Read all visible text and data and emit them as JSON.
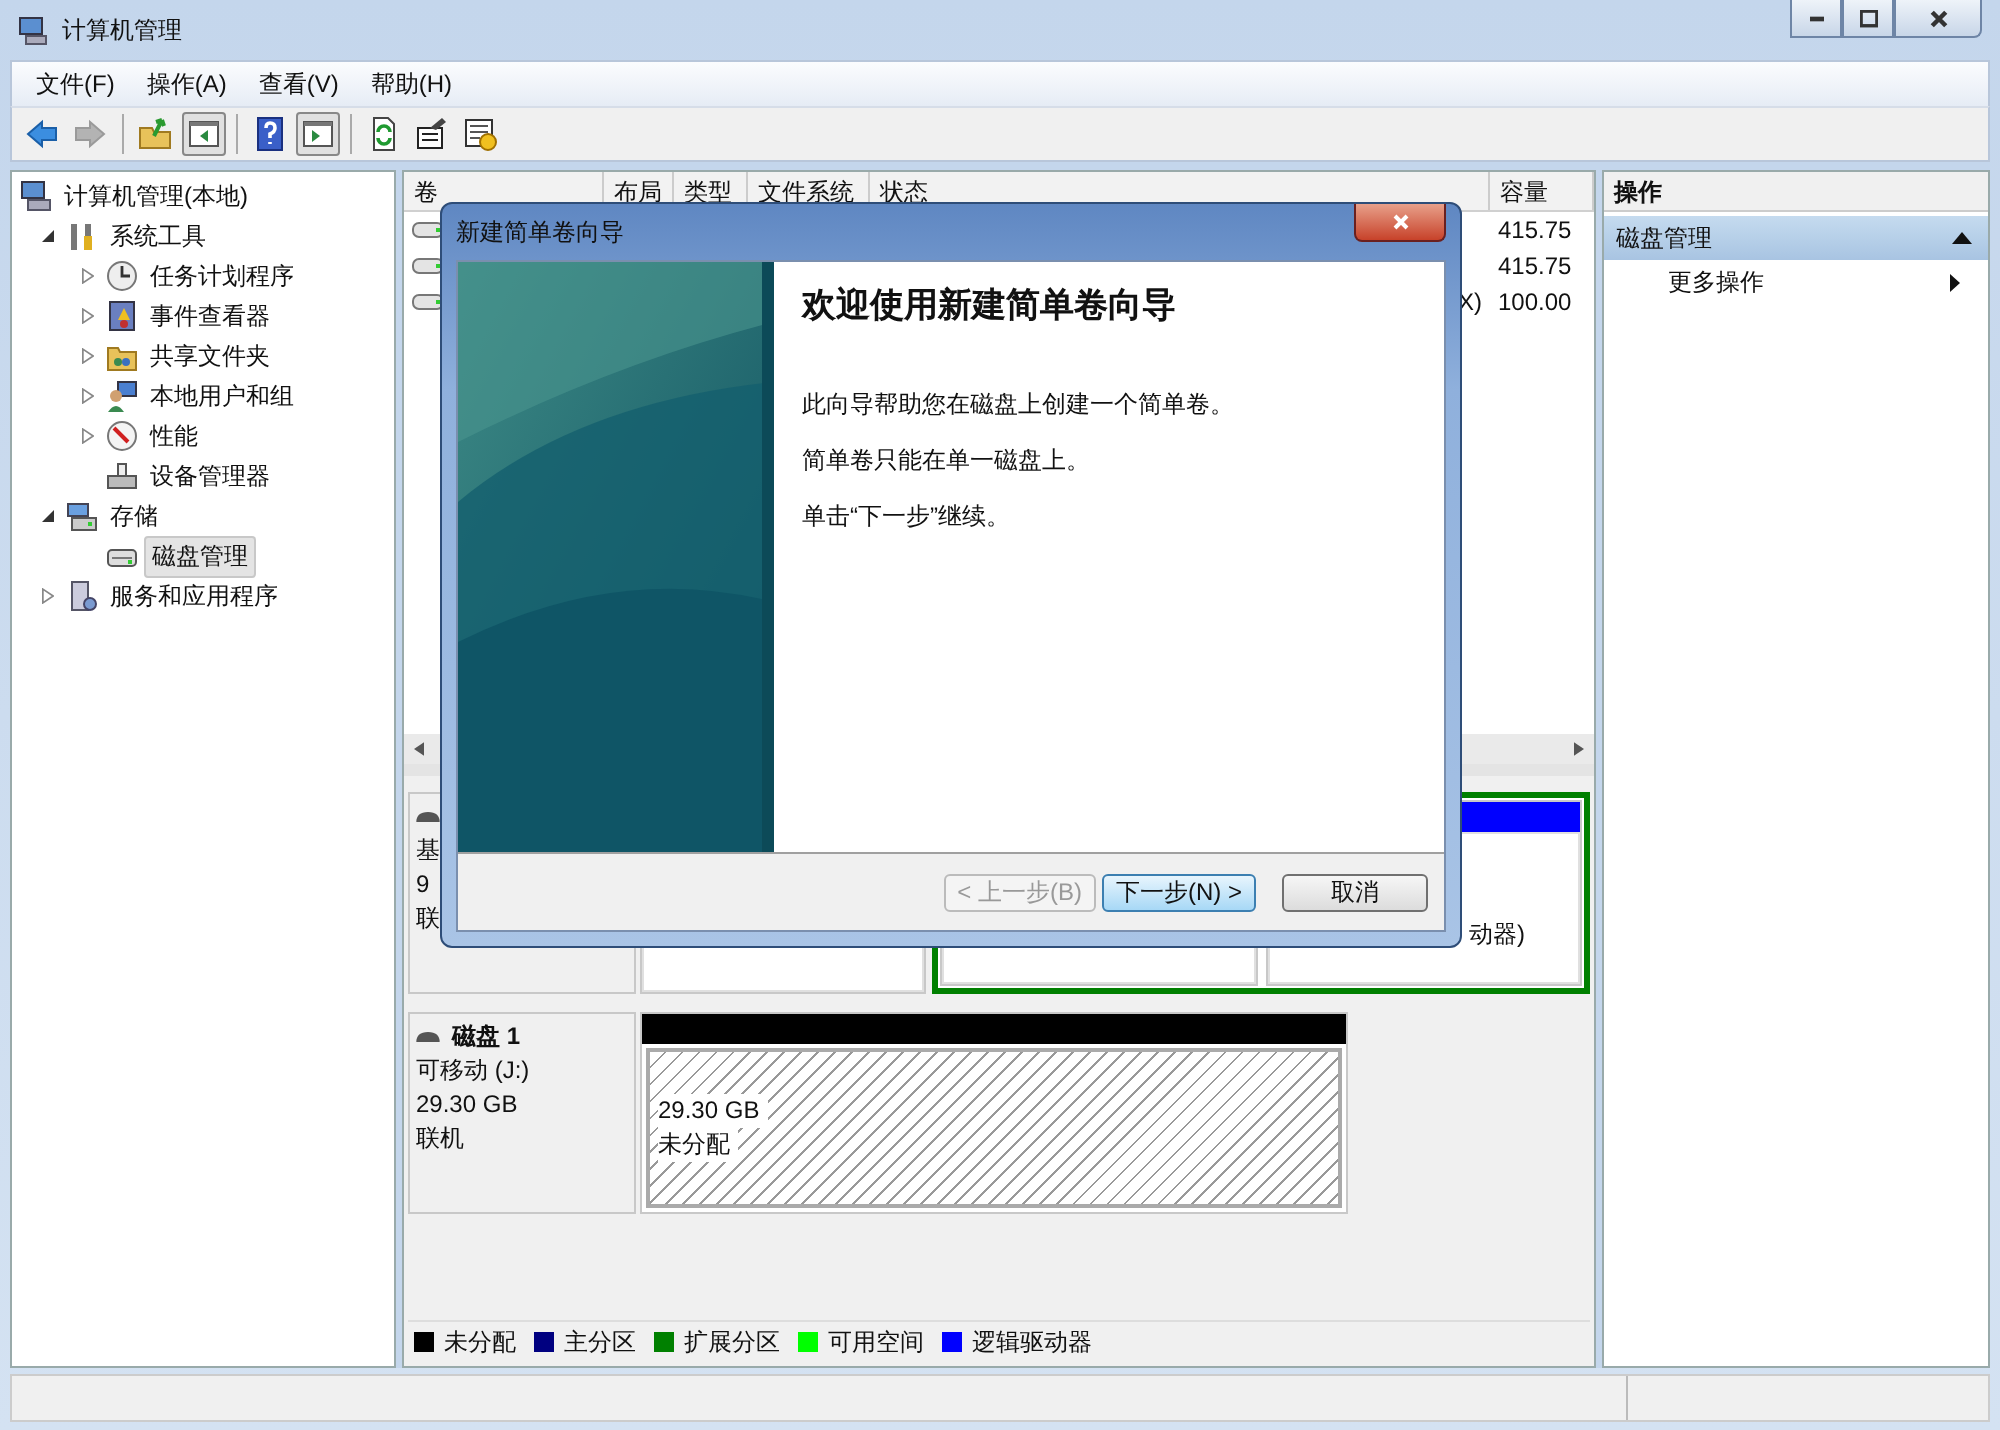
{
  "window": {
    "title": "计算机管理"
  },
  "menu": [
    "文件(F)",
    "操作(A)",
    "查看(V)",
    "帮助(H)"
  ],
  "toolbar": [
    {
      "disabled": false,
      "pressed": false
    },
    {
      "disabled": true,
      "pressed": false
    },
    {
      "disabled": false,
      "pressed": false
    },
    {
      "disabled": false,
      "pressed": true
    },
    {
      "disabled": false,
      "pressed": false
    },
    {
      "disabled": false,
      "pressed": true
    },
    {
      "disabled": false,
      "pressed": false
    },
    {
      "disabled": false,
      "pressed": false
    },
    {
      "disabled": false,
      "pressed": false
    }
  ],
  "tree": [
    {
      "label": "计算机管理(本地)",
      "kind": "root",
      "selected": false,
      "children": [
        {
          "label": "系统工具",
          "kind": "node",
          "expanded": true,
          "selected": false,
          "children": [
            {
              "label": "任务计划程序",
              "kind": "node",
              "expanded": false,
              "selected": false
            },
            {
              "label": "事件查看器",
              "kind": "node",
              "expanded": false,
              "selected": false
            },
            {
              "label": "共享文件夹",
              "kind": "node",
              "expanded": false,
              "selected": false
            },
            {
              "label": "本地用户和组",
              "kind": "node",
              "expanded": false,
              "selected": false
            },
            {
              "label": "性能",
              "kind": "node",
              "expanded": false,
              "selected": false
            },
            {
              "label": "设备管理器",
              "kind": "leaf",
              "selected": false
            }
          ]
        },
        {
          "label": "存储",
          "kind": "node",
          "expanded": true,
          "selected": false,
          "children": [
            {
              "label": "磁盘管理",
              "kind": "leaf",
              "selected": true
            }
          ]
        },
        {
          "label": "服务和应用程序",
          "kind": "node",
          "expanded": false,
          "selected": false
        }
      ]
    }
  ],
  "table": {
    "columns": [
      "卷",
      "布局",
      "类型",
      "文件系统",
      "状态",
      "容量"
    ],
    "rows": [
      {
        "status": "",
        "capacity": "415.75"
      },
      {
        "status": "",
        "capacity": "415.75"
      },
      {
        "status": "X)",
        "capacity": "100.00"
      }
    ]
  },
  "disks": [
    {
      "lines": [
        "基",
        "9",
        "联"
      ],
      "partitions": [
        {
          "kind": "plain"
        },
        {
          "kind": "extended",
          "children": [
            {
              "kind": "plain"
            },
            {
              "kind": "logical",
              "lines": [
                "动器)"
              ]
            }
          ]
        }
      ]
    },
    {
      "name": "磁盘 1",
      "lines": [
        "可移动 (J:)",
        "29.30 GB",
        "联机"
      ],
      "partitions": [
        {
          "kind": "unallocated",
          "lines": [
            "29.30 GB",
            "未分配"
          ]
        }
      ]
    }
  ],
  "legend": [
    {
      "label": "未分配",
      "color": "#000000"
    },
    {
      "label": "主分区",
      "color": "#000080"
    },
    {
      "label": "扩展分区",
      "color": "#008000"
    },
    {
      "label": "可用空间",
      "color": "#00ff00"
    },
    {
      "label": "逻辑驱动器",
      "color": "#0000ff"
    }
  ],
  "actions": {
    "title": "操作",
    "section": {
      "label": "磁盘管理",
      "expanded": true
    },
    "items": [
      "更多操作"
    ]
  },
  "dialog": {
    "title": "新建简单卷向导",
    "heading": "欢迎使用新建简单卷向导",
    "paragraphs": [
      "此向导帮助您在磁盘上创建一个简单卷。",
      "简单卷只能在单一磁盘上。",
      "单击“下一步”继续。"
    ],
    "buttons": [
      {
        "label": "< 上一步(B)",
        "disabled": true,
        "default": false
      },
      {
        "label": "下一步(N) >",
        "disabled": false,
        "default": true
      },
      {
        "label": "取消",
        "disabled": false,
        "default": false
      }
    ]
  }
}
